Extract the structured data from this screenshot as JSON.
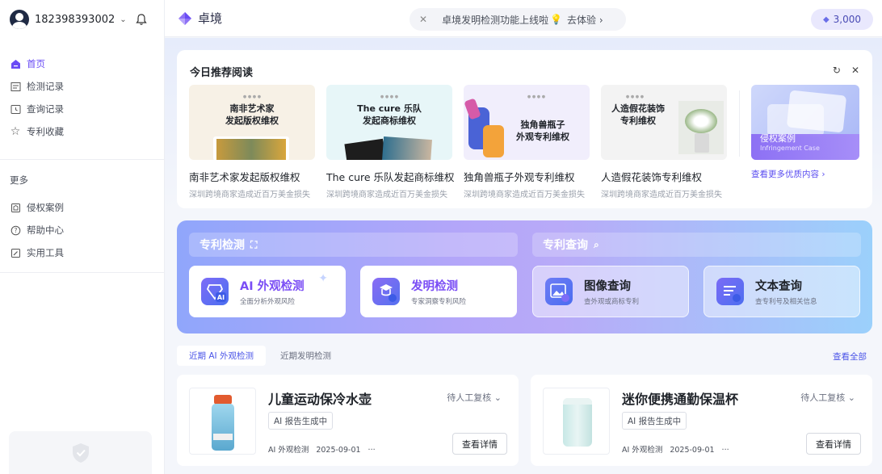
{
  "user": {
    "phone": "182398393002"
  },
  "sidebar": {
    "primary": [
      {
        "label": "首页",
        "icon": "home-icon",
        "active": true
      },
      {
        "label": "检测记录",
        "icon": "list-icon"
      },
      {
        "label": "查询记录",
        "icon": "history-icon"
      },
      {
        "label": "专利收藏",
        "icon": "star-icon"
      }
    ],
    "more_title": "更多",
    "secondary": [
      {
        "label": "侵权案例",
        "icon": "case-icon"
      },
      {
        "label": "帮助中心",
        "icon": "help-icon"
      },
      {
        "label": "实用工具",
        "icon": "tool-icon"
      }
    ]
  },
  "topbar": {
    "brand": "卓境",
    "notice_text": "卓境发明检测功能上线啦",
    "notice_action": "去体验 ›",
    "credits": "3,000"
  },
  "recommend": {
    "title": "今日推荐阅读",
    "articles": [
      {
        "thumb_line1": "南非艺术家",
        "thumb_line2": "发起版权维权",
        "title": "南非艺术家发起版权维权",
        "sub": "深圳跨境商家造成近百万美金损失"
      },
      {
        "thumb_line1": "The cure 乐队",
        "thumb_line2": "发起商标维权",
        "title": "The cure 乐队发起商标维权",
        "sub": "深圳跨境商家造成近百万美金损失"
      },
      {
        "thumb_line1": "独角兽瓶子",
        "thumb_line2": "外观专利维权",
        "title": "独角兽瓶子外观专利维权",
        "sub": "深圳跨境商家造成近百万美金损失"
      },
      {
        "thumb_line1": "人造假花装饰",
        "thumb_line2": "专利维权",
        "title": "人造假花装饰专利维权",
        "sub": "深圳跨境商家造成近百万美金损失"
      }
    ],
    "more_card_title": "侵权案例",
    "more_card_sub": "Infringement Case",
    "more_link": "查看更多优质内容 ›"
  },
  "functions": {
    "patent_check_title": "专利检测",
    "patent_query_title": "专利查询",
    "buttons": [
      {
        "title": "AI 外观检测",
        "sub": "全面分析外观风险"
      },
      {
        "title": "发明检测",
        "sub": "专家洞察专利风险"
      },
      {
        "title": "图像查询",
        "sub": "查外观或商标专利"
      },
      {
        "title": "文本查询",
        "sub": "查专利号及相关信息"
      }
    ]
  },
  "tabs": {
    "items": [
      "近期 AI 外观检测",
      "近期发明检测"
    ],
    "view_all": "查看全部"
  },
  "products": [
    {
      "name": "儿童运动保冷水壶",
      "status": "待人工复核",
      "badge": "AI 报告生成中",
      "type": "AI 外观检测",
      "date": "2025-09-01",
      "more": "···",
      "action": "查看详情"
    },
    {
      "name": "迷你便携通勤保温杯",
      "status": "待人工复核",
      "badge": "AI 报告生成中",
      "type": "AI 外观检测",
      "date": "2025-09-01",
      "more": "···",
      "action": "查看详情"
    }
  ],
  "colors": {
    "accent": "#6a4cf5",
    "link": "#4c56e8"
  }
}
